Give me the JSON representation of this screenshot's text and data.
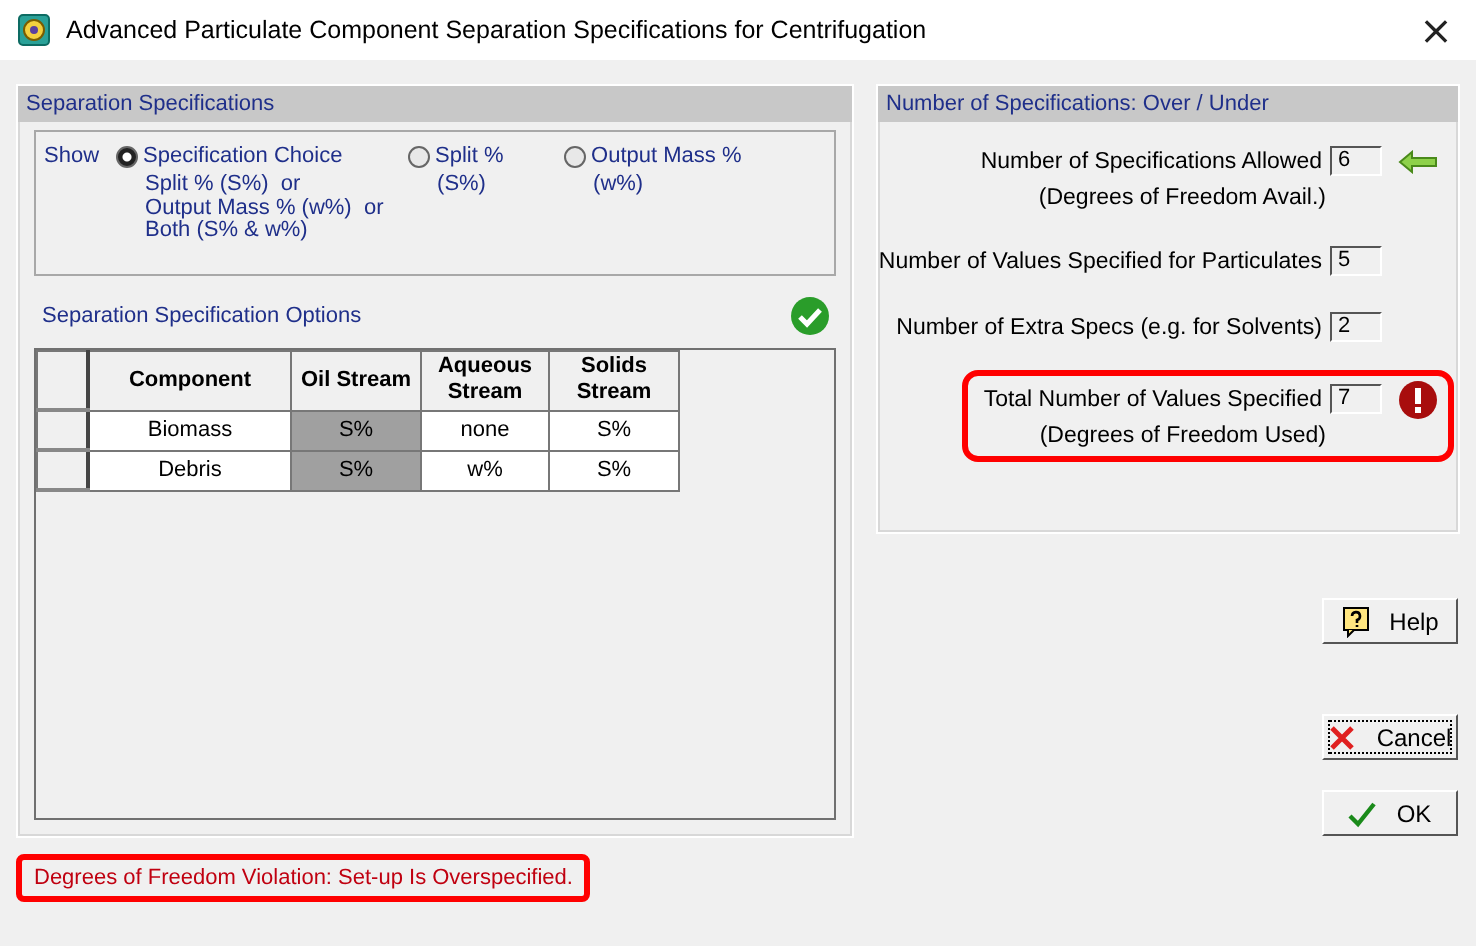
{
  "window": {
    "title": "Advanced Particulate Component Separation Specifications for Centrifugation",
    "close": "×"
  },
  "separation_specifications": {
    "title": "Separation Specifications",
    "show_label": "Show",
    "options": [
      {
        "label": "Specification Choice",
        "description": [
          "Split % (S%)  or",
          "Output Mass % (w%)  or",
          "Both (S% & w%)"
        ],
        "selected": true
      },
      {
        "label": "Split %",
        "description": [
          "(S%)"
        ],
        "selected": false
      },
      {
        "label": "Output Mass %",
        "description": [
          "(w%)"
        ],
        "selected": false
      }
    ]
  },
  "options_table": {
    "title": "Separation Specification Options",
    "valid": true,
    "columns": [
      {
        "label": "Component",
        "shaded": false
      },
      {
        "label": "Oil Stream",
        "shaded": true
      },
      {
        "label": "Aqueous Stream",
        "shaded": false
      },
      {
        "label": "Solids Stream",
        "shaded": false
      }
    ],
    "rows": [
      [
        "Biomass",
        "S%",
        "none",
        "S%"
      ],
      [
        "Debris",
        "S%",
        "w%",
        "S%"
      ]
    ]
  },
  "counts": {
    "title": "Number of Specifications: Over / Under",
    "items": [
      {
        "label": "Number of Specifications Allowed",
        "note": "(Degrees of Freedom Avail.)",
        "value": "6",
        "pointer": true,
        "error": false,
        "highlighted": false
      },
      {
        "label": "Number of Values Specified for Particulates",
        "value": "5",
        "pointer": false,
        "error": false,
        "highlighted": false
      },
      {
        "label": "Number of Extra Specs (e.g. for Solvents)",
        "value": "2",
        "pointer": false,
        "error": false,
        "highlighted": false
      },
      {
        "label": "Total Number of Values Specified",
        "note": "(Degrees of Freedom Used)",
        "value": "7",
        "pointer": false,
        "error": true,
        "highlighted": true
      }
    ]
  },
  "buttons": [
    {
      "label": "Help",
      "kind": "help",
      "focused": false
    },
    {
      "label": "Cancel",
      "kind": "cancel",
      "focused": true
    },
    {
      "label": "OK",
      "kind": "ok",
      "focused": false
    }
  ],
  "status_message": {
    "text": "Degrees of Freedom Violation: Set-up Is Overspecified.",
    "highlighted": true
  }
}
